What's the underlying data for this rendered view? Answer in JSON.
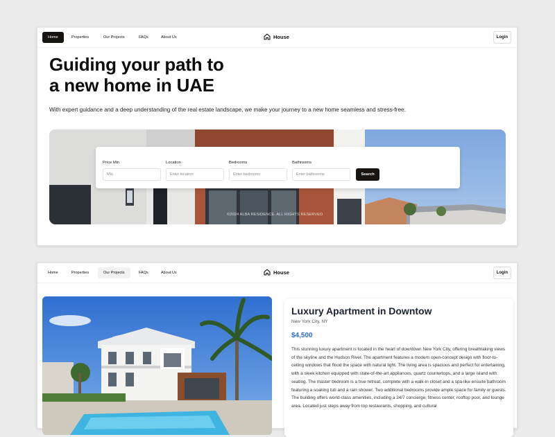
{
  "nav1": {
    "items": [
      "Home",
      "Properties",
      "Our Projects",
      "FAQs",
      "About Us"
    ],
    "active": "Home",
    "brand": "House",
    "login": "Login"
  },
  "hero": {
    "title_line1": "Guiding your path to",
    "title_line2": "a new home in UAE",
    "subtitle": "With expert guidance and a deep understanding of the real estate landscape, we make your journey to a new home seamless and stress-free.",
    "copyright": "©2024 ALBA RESIDENCE. ALL RIGHTS RESERVED"
  },
  "search": {
    "fields": [
      {
        "label": "Price Min",
        "placeholder": "Min"
      },
      {
        "label": "Location",
        "placeholder": "Enter location"
      },
      {
        "label": "Bedrooms",
        "placeholder": "Enter bedrooms"
      },
      {
        "label": "Bathrooms",
        "placeholder": "Enter bathrooms"
      }
    ],
    "button": "Search"
  },
  "nav2": {
    "items": [
      "Home",
      "Properties",
      "Our Projects",
      "FAQs",
      "About Us"
    ],
    "active": "Our Projects",
    "brand": "House",
    "login": "Login"
  },
  "listing": {
    "title": "Luxury Apartment in Downtow",
    "location": "New York City, NY",
    "price": "$4,500",
    "description": "This stunning luxury apartment is located in the heart of downtown New York City, offering breathtaking views of the skyline and the Hudson River. The apartment features a modern open-concept design with floor-to-ceiling windows that flood the space with natural light. The living area is spacious and perfect for entertaining, with a sleek kitchen equipped with state-of-the-art appliances, quartz countertops, and a large island with seating. The master bedroom is a true retreat, complete with a walk-in closet and a spa-like ensuite bathroom featuring a soaking tub and a rain shower. Two additional bedrooms provide ample space for family or guests. The building offers world-class amenities, including a 24/7 concierge, fitness center, rooftop pool, and lounge area. Located just steps away from top restaurants, shopping, and cultural"
  },
  "icons": {
    "brand": "house-icon"
  },
  "colors": {
    "dark": "#161310",
    "price": "#2f6bd6",
    "background": "#ebebeb"
  }
}
